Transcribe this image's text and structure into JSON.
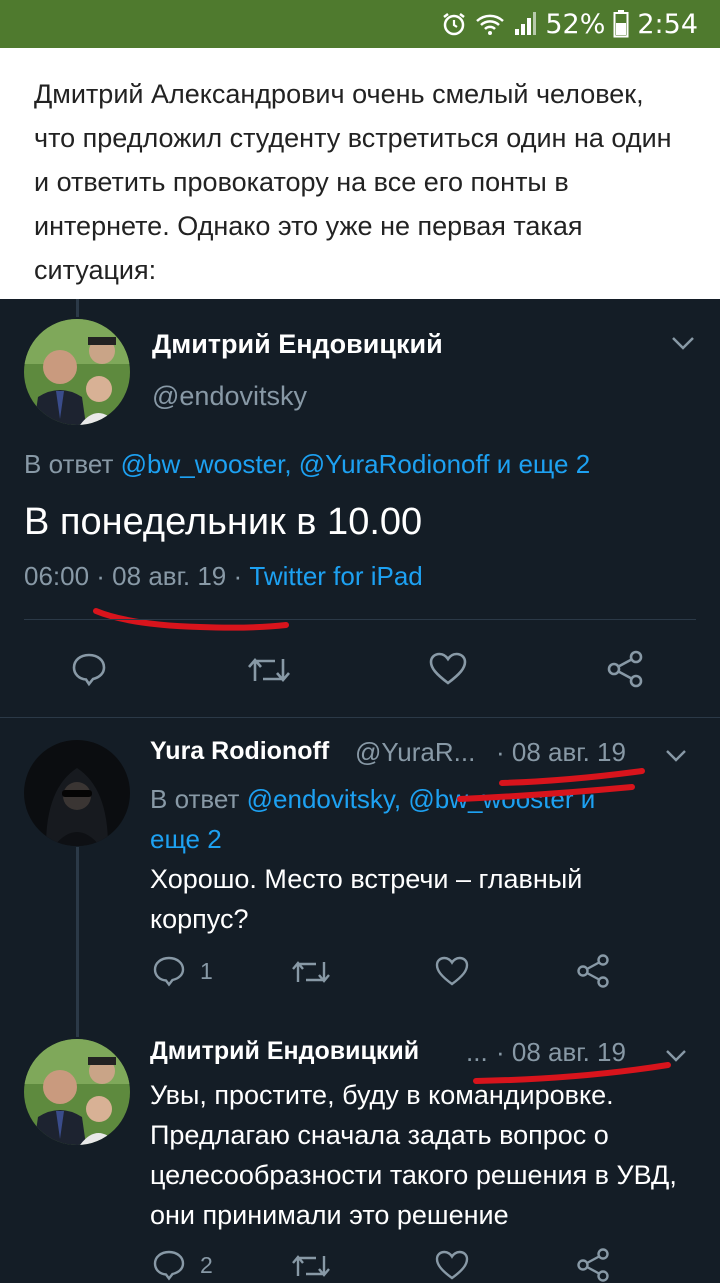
{
  "status_bar": {
    "battery": "52%",
    "time": "2:54",
    "icons": [
      "alarm-icon",
      "wifi-icon",
      "signal-icon",
      "battery-icon"
    ]
  },
  "article": {
    "paragraph": "Дмитрий Александрович очень смелый человек, что предложил студенту встретиться один на один и ответить провокатору на все его понты в интернете. Однако это уже не первая такая ситуация:"
  },
  "main_tweet": {
    "name": "Дмитрий Ендовицкий",
    "handle": "@endovitsky",
    "reply_prefix": "В ответ",
    "reply_to": "@bw_wooster, @YuraRodionoff и еще 2",
    "text": "В понедельник в 10.00",
    "time": "06:00 · 08 авг. 19 · ",
    "source": "Twitter for iPad"
  },
  "reply1": {
    "name": "Yura Rodionoff",
    "handle": "@YuraR...",
    "date": "· 08 авг. 19",
    "reply_prefix": "В ответ",
    "reply_to_line1": "@endovitsky, @bw_wooster и",
    "reply_to_line2": "еще 2",
    "text": "Хорошо. Место встречи – главный корпус?",
    "reply_count": "1"
  },
  "reply2": {
    "name": "Дмитрий Ендовицкий",
    "handle": "...",
    "date": "· 08 авг. 19",
    "text": "Увы, простите, буду в командировке. Предлагаю сначала задать вопрос о целесообразности такого решения в УВД, они принимали это решение",
    "reply_count": "2"
  },
  "colors": {
    "status_bar": "#4f7a2e",
    "tweet_background": "#141d26",
    "link": "#1da1f2",
    "secondary_text": "#8899a6",
    "annotation_red": "#d8141c"
  }
}
